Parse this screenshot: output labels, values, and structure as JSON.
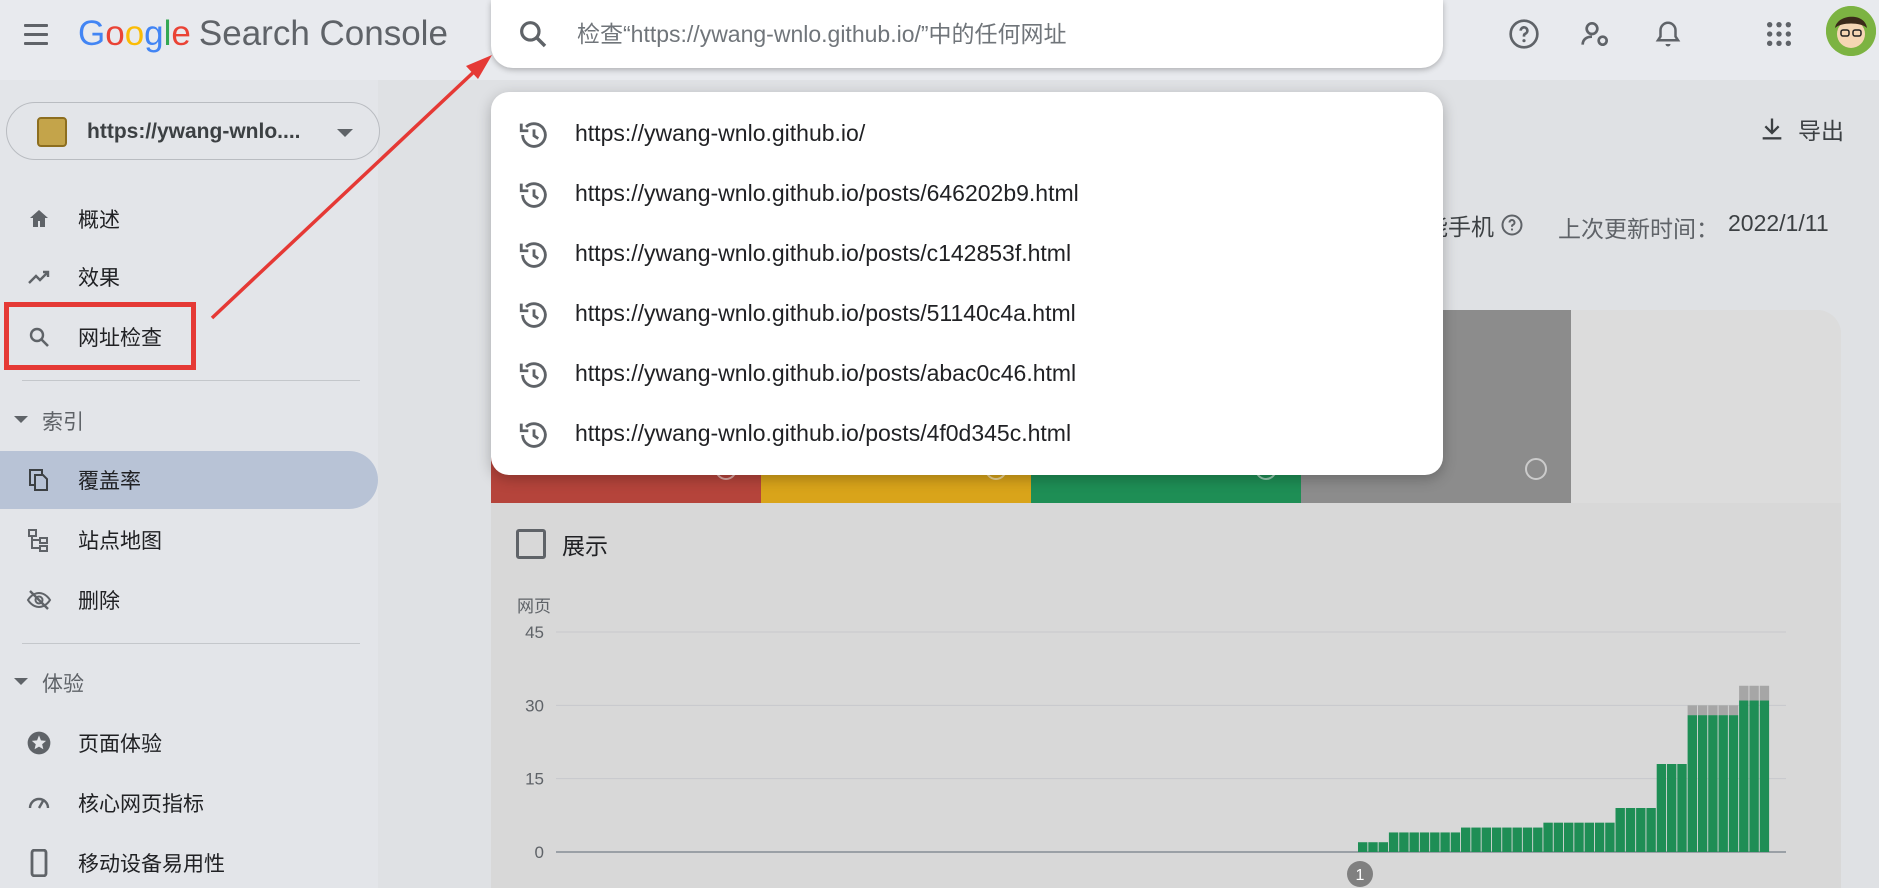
{
  "app": {
    "title_letters": [
      "G",
      "o",
      "o",
      "g",
      "l",
      "e"
    ],
    "product": "Search Console"
  },
  "search": {
    "placeholder": "检查“https://ywang-wnlo.github.io/”中的任何网址"
  },
  "dropdown": {
    "items": [
      "https://ywang-wnlo.github.io/",
      "https://ywang-wnlo.github.io/posts/646202b9.html",
      "https://ywang-wnlo.github.io/posts/c142853f.html",
      "https://ywang-wnlo.github.io/posts/51140c4a.html",
      "https://ywang-wnlo.github.io/posts/abac0c46.html",
      "https://ywang-wnlo.github.io/posts/4f0d345c.html"
    ]
  },
  "property": {
    "label": "https://ywang-wnlo...."
  },
  "sidebar": {
    "top": [
      {
        "label": "概述",
        "icon": "home-icon"
      },
      {
        "label": "效果",
        "icon": "trending-up-icon"
      },
      {
        "label": "网址检查",
        "icon": "search-icon"
      }
    ],
    "section_index": "索引",
    "index_items": [
      {
        "label": "覆盖率",
        "icon": "copy-icon",
        "active": true
      },
      {
        "label": "站点地图",
        "icon": "sitemap-icon"
      },
      {
        "label": "删除",
        "icon": "eye-off-icon"
      }
    ],
    "section_experience": "体验",
    "experience_items": [
      {
        "label": "页面体验",
        "icon": "star-circle-icon"
      },
      {
        "label": "核心网页指标",
        "icon": "speedometer-icon"
      },
      {
        "label": "移动设备易用性",
        "icon": "smartphone-icon"
      }
    ]
  },
  "main": {
    "export_label": "导出",
    "device_label": "能手机",
    "last_updated_label": "上次更新时间：",
    "last_updated_value": "2022/1/11",
    "show_label": "展示"
  },
  "colors": {
    "error": "#b5443b",
    "warning": "#d9a41a",
    "valid": "#1e8e55",
    "excluded": "#8c8c8c",
    "accent_red": "#e53935"
  },
  "chart_data": {
    "type": "bar",
    "ylabel": "网页",
    "yticks": [
      0,
      15,
      30,
      45
    ],
    "ylim": [
      0,
      45
    ],
    "annotation": "1",
    "series": [
      {
        "name": "valid",
        "values": [
          2,
          2,
          2,
          4,
          4,
          4,
          4,
          4,
          4,
          4,
          5,
          5,
          5,
          5,
          5,
          5,
          5,
          5,
          6,
          6,
          6,
          6,
          6,
          6,
          6,
          9,
          9,
          9,
          9,
          18,
          18,
          18,
          28,
          28,
          28,
          28,
          28,
          31,
          31,
          31
        ]
      },
      {
        "name": "excluded",
        "values": [
          0,
          0,
          0,
          0,
          0,
          0,
          0,
          0,
          0,
          0,
          0,
          0,
          0,
          0,
          0,
          0,
          0,
          0,
          0,
          0,
          0,
          0,
          0,
          0,
          0,
          0,
          0,
          0,
          0,
          0,
          0,
          0,
          2,
          2,
          2,
          2,
          2,
          3,
          3,
          3
        ]
      }
    ]
  }
}
